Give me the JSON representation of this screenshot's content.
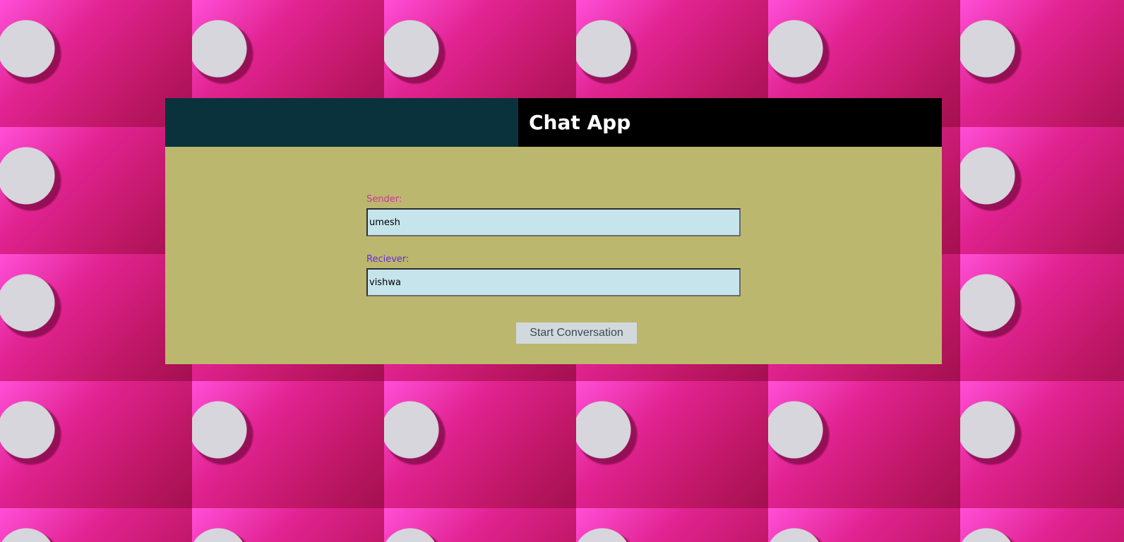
{
  "header": {
    "title": "Chat App"
  },
  "form": {
    "sender_label": "Sender:",
    "sender_value": "umesh",
    "receiver_label": "Reciever:",
    "receiver_value": "vishwa",
    "submit_label": "Start Conversation"
  },
  "colors": {
    "header_left": "#0a323c",
    "header_right": "#000000",
    "panel_bg": "#bcb76e",
    "input_bg": "#c6e4ec",
    "sender_label": "#c9379b",
    "receiver_label": "#6a2bdb",
    "button_bg": "#d2d9dd",
    "background_pink": "#e0207f"
  },
  "background": {
    "icon": "chat-bubble-icon"
  }
}
